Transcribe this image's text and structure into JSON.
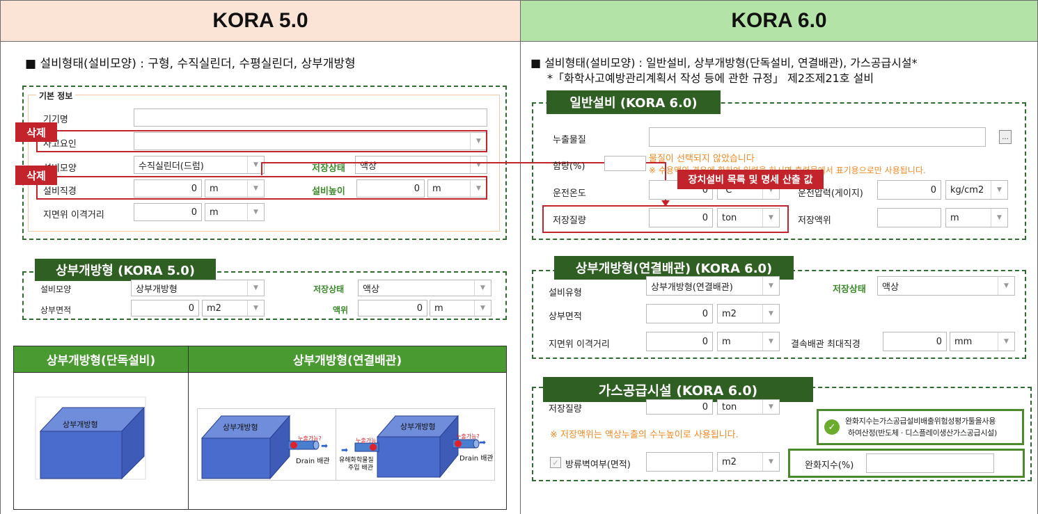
{
  "left": {
    "header": "KORA 5.0",
    "bullet": "■ 설비형태(설비모양) : 구형, 수직실린더, 수평실린더, 상부개방형",
    "basic": {
      "legend": "기본 정보",
      "rows": {
        "name_label": "기기명",
        "cause_label": "사고요인",
        "shape_label": "설비모양",
        "shape_value": "수직실린더(드럼)",
        "store_state_label": "저장상태",
        "store_state_value": "액상",
        "diameter_label": "설비직경",
        "diameter_value": "0",
        "diameter_unit": "m",
        "height_label": "설비높이",
        "height_value": "0",
        "height_unit": "m",
        "ground_label": "지면위 이격거리",
        "ground_value": "0",
        "ground_unit": "m"
      },
      "delete_tag_1": "삭제",
      "delete_tag_2": "삭제"
    },
    "open_top": {
      "tag": "상부개방형 (KORA 5.0)",
      "shape_label": "설비모양",
      "shape_value": "상부개방형",
      "state_label": "저장상태",
      "state_value": "액상",
      "area_label": "상부면적",
      "area_value": "0",
      "area_unit": "m2",
      "level_label": "액위",
      "level_value": "0",
      "level_unit": "m"
    },
    "table": {
      "col1": "상부개방형(단독설비)",
      "col2": "상부개방형(연결배관)",
      "box_label": "상부개방형",
      "box_label_2": "상부개방형",
      "box_label_3": "상부개방형",
      "leak_1": "누출가능?",
      "leak_2": "누출가능",
      "leak_3": "누출가능?",
      "drain_1": "Drain 배관",
      "drain_2": "Drain 배관",
      "inject_1": "유해화학물질",
      "inject_2": "주입 배관"
    }
  },
  "right": {
    "header": "KORA 6.0",
    "bullet_1": "■ 설비형태(설비모양) : 일반설비, 상부개방형(단독설비, 연결배관), 가스공급시설*",
    "bullet_2": "*「화학사고예방관리계획서 작성 등에 관한 규정」 제2조제21호 설비",
    "general": {
      "tag": "일반설비 (KORA 6.0)",
      "leak_label": "누출물질",
      "more_button": "...",
      "content_label": "함량(%)",
      "warn_1": "물질이 선택되지 않았습니다",
      "warn_2": "※ 수용액의 경우에 한하여 입력을 하시면 출력물에서 표기용으로만 사용됩니다.",
      "temp_label": "운전온도",
      "temp_value": "0",
      "temp_unit": "℃",
      "pressure_label": "운전압력(게이지)",
      "pressure_value": "0",
      "pressure_unit": "kg/cm2",
      "storage_label": "저장질량",
      "storage_value": "0",
      "storage_unit": "ton",
      "level_label": "저장액위",
      "level_value": "",
      "level_unit": "m",
      "callout": "장치설비 목록 및 명세 산출 값"
    },
    "open_top": {
      "tag": "상부개방형(연결배관) (KORA 6.0)",
      "type_label": "설비유형",
      "type_value": "상부개방형(연결배관)",
      "state_label": "저장상태",
      "state_value": "액상",
      "area_label": "상부면적",
      "area_value": "0",
      "area_unit": "m2",
      "ground_label": "지면위 이격거리",
      "ground_value": "0",
      "ground_unit": "m",
      "pipe_label": "결속배관 최대직경",
      "pipe_value": "0",
      "pipe_unit": "mm"
    },
    "gas": {
      "tag": "가스공급시설 (KORA 6.0)",
      "storage_label": "저장질량",
      "storage_value": "0",
      "storage_unit": "ton",
      "note": "※ 저장액위는 액상누출의 수누높이로 사용됩니다.",
      "dike_label": "방류벽여부(면적)",
      "dike_unit": "m2",
      "mitigation_label": "완화지수(%)",
      "info_line_1": "완화지수는가스공급설비배출위험성평가툴을사용",
      "info_line_2": "하여산정(반도체 · 디스플레이생산가스공급시설)"
    }
  },
  "colors": {
    "left_header_bg": "#fbe3d6",
    "right_header_bg": "#b4e3a8",
    "tag_green": "#2f5f22",
    "delete_red": "#c3232b",
    "warn_orange": "#f08a24",
    "table_header_green": "#4a9a32"
  }
}
